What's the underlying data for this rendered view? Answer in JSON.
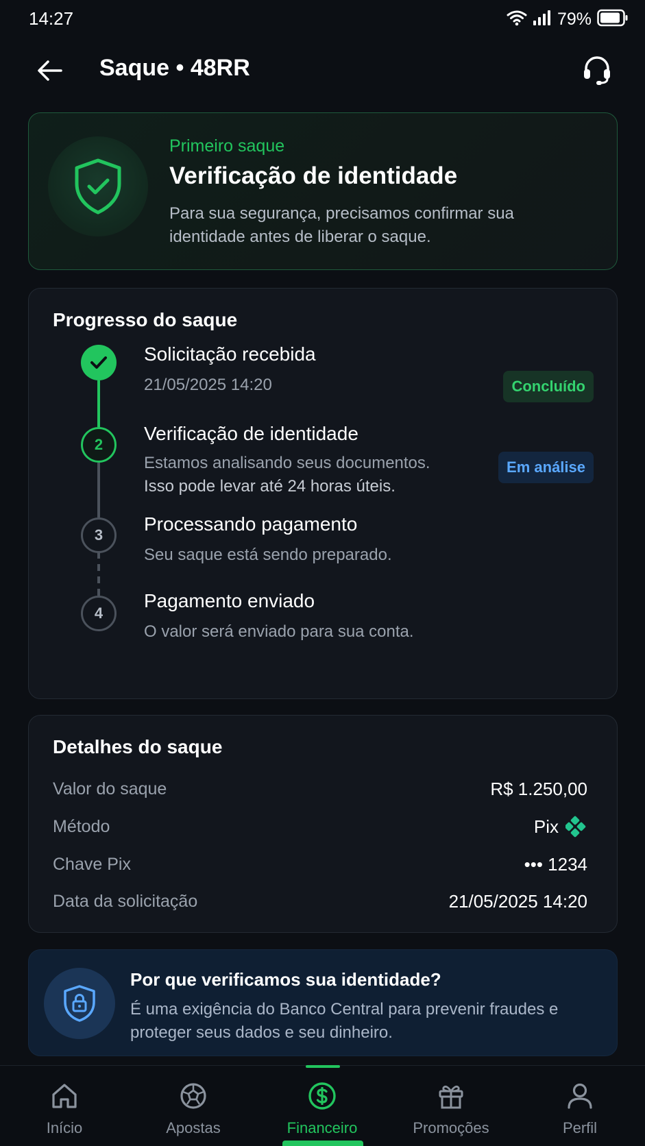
{
  "status_bar": {
    "time": "14:27",
    "battery": "79%"
  },
  "header": {
    "title": "Saque • 48RR"
  },
  "hero": {
    "kicker": "Primeiro saque",
    "title": "Verificação de identidade",
    "description": "Para sua segurança, precisamos confirmar sua identidade antes de liberar o saque."
  },
  "progress": {
    "title": "Progresso do saque",
    "steps": [
      {
        "number": "1",
        "title": "Solicitação recebida",
        "subtitle": "21/05/2025 14:20",
        "badge": "Concluído",
        "state": "done"
      },
      {
        "number": "2",
        "title": "Verificação de identidade",
        "subtitle": "Estamos analisando seus documentos.",
        "subtitle2": "Isso pode levar até 24 horas úteis.",
        "badge": "Em análise",
        "state": "active"
      },
      {
        "number": "3",
        "title": "Processando pagamento",
        "subtitle": "Seu saque está sendo preparado.",
        "state": "pending"
      },
      {
        "number": "4",
        "title": "Pagamento enviado",
        "subtitle": "O valor será enviado para sua conta.",
        "state": "pending"
      }
    ]
  },
  "details": {
    "title": "Detalhes do saque",
    "rows": [
      {
        "label": "Valor do saque",
        "value": "R$ 1.250,00"
      },
      {
        "label": "Método",
        "value": "Pix"
      },
      {
        "label": "Chave Pix",
        "value": "••• 1234"
      },
      {
        "label": "Data da solicitação",
        "value": "21/05/2025 14:20"
      }
    ]
  },
  "info": {
    "title": "Por que verificamos sua identidade?",
    "description": "É uma exigência do Banco Central para prevenir fraudes e proteger seus dados e seu dinheiro."
  },
  "nav": {
    "items": [
      {
        "label": "Início",
        "icon": "home-icon"
      },
      {
        "label": "Apostas",
        "icon": "soccer-ball-icon"
      },
      {
        "label": "Financeiro",
        "icon": "dollar-circle-icon",
        "active": true
      },
      {
        "label": "Promoções",
        "icon": "gift-icon"
      },
      {
        "label": "Perfil",
        "icon": "user-icon"
      }
    ]
  },
  "colors": {
    "accent": "#22c55e",
    "info": "#5aa8ff",
    "background": "#0c0f14",
    "card": "#12161d"
  }
}
